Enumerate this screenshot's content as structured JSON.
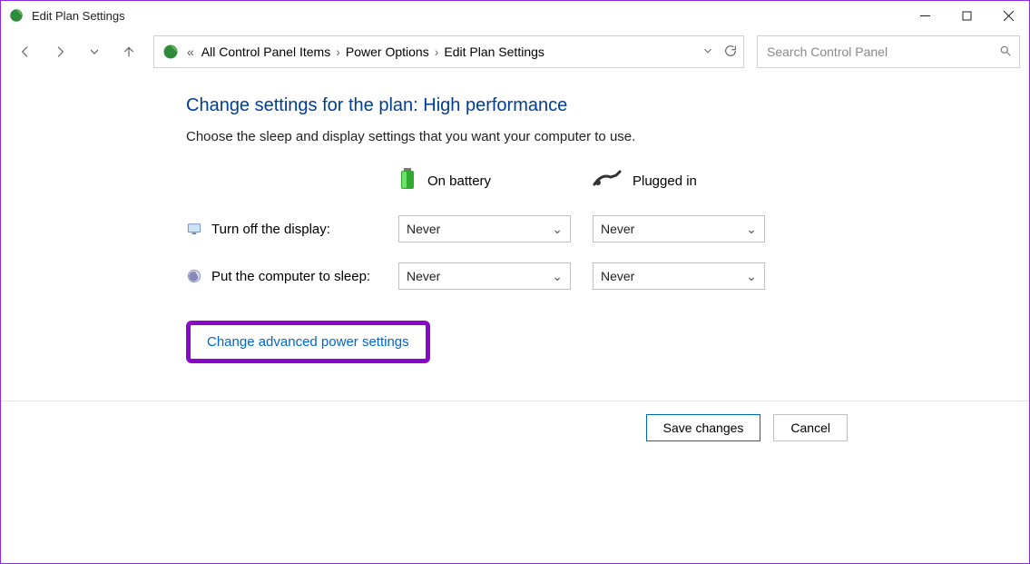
{
  "window": {
    "title": "Edit Plan Settings"
  },
  "breadcrumb": {
    "items": [
      "All Control Panel Items",
      "Power Options",
      "Edit Plan Settings"
    ]
  },
  "search": {
    "placeholder": "Search Control Panel"
  },
  "heading": "Change settings for the plan: High performance",
  "subtext": "Choose the sleep and display settings that you want your computer to use.",
  "columns": {
    "battery": "On battery",
    "plugged": "Plugged in"
  },
  "rows": {
    "display": {
      "label": "Turn off the display:",
      "battery": "Never",
      "plugged": "Never"
    },
    "sleep": {
      "label": "Put the computer to sleep:",
      "battery": "Never",
      "plugged": "Never"
    }
  },
  "advanced_link": "Change advanced power settings",
  "buttons": {
    "save": "Save changes",
    "cancel": "Cancel"
  }
}
